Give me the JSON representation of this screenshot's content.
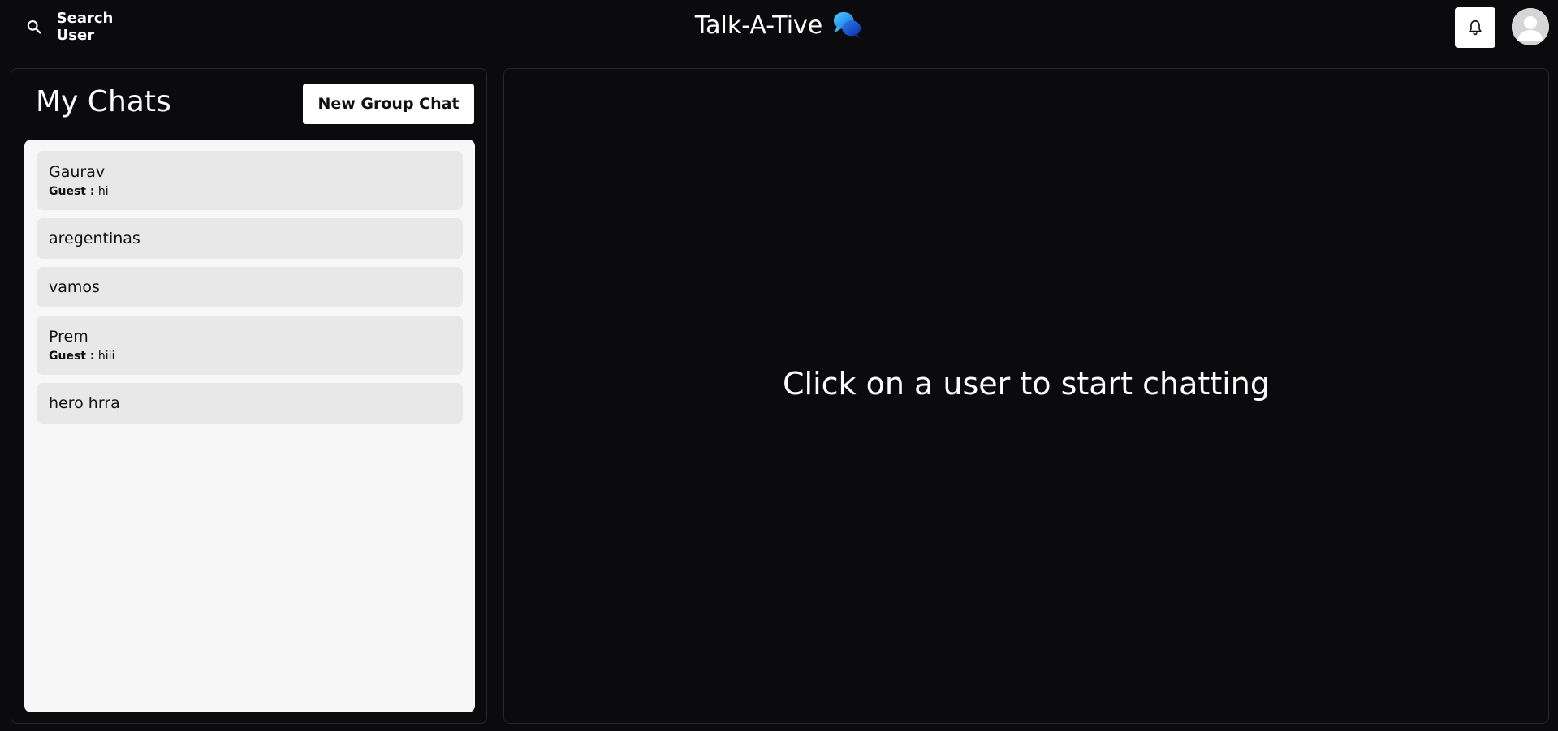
{
  "header": {
    "search_label": "Search User",
    "app_title": "Talk-A-Tive",
    "icons": [
      "search-icon",
      "chat-bubbles-logo-icon",
      "bell-icon",
      "avatar-icon"
    ]
  },
  "sidebar": {
    "title": "My Chats",
    "new_group_label": "New Group Chat",
    "chats": [
      {
        "name": "Gaurav",
        "sender": "Guest :",
        "message": "hi"
      },
      {
        "name": "aregentinas"
      },
      {
        "name": "vamos"
      },
      {
        "name": "Prem",
        "sender": "Guest :",
        "message": "hiii"
      },
      {
        "name": "hero hrra"
      }
    ]
  },
  "main": {
    "placeholder": "Click on a user to start chatting"
  },
  "colors": {
    "background": "#0b0b0d",
    "list_background": "#f7f7f7",
    "item_background": "#e8e8e8",
    "logo_accent": "#1e9bf0"
  }
}
